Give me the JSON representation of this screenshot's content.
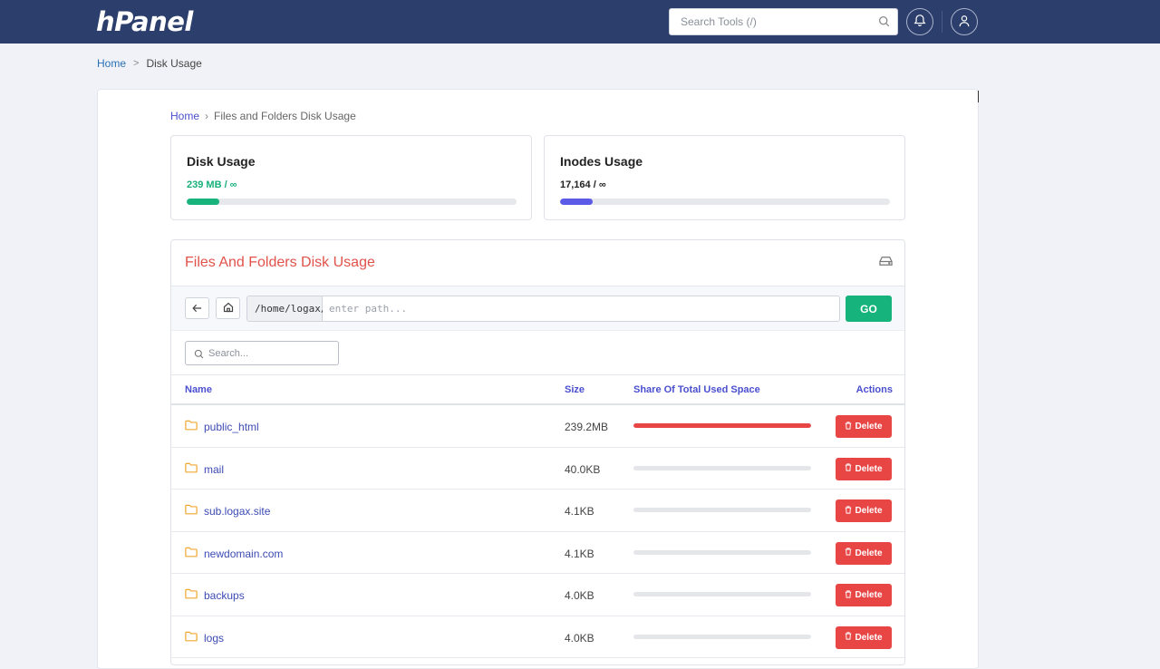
{
  "header": {
    "logo": "hPanel",
    "search_placeholder": "Search Tools (/)"
  },
  "breadcrumb_top": {
    "home": "Home",
    "separator": ">",
    "current": "Disk Usage"
  },
  "breadcrumb_inner": {
    "home": "Home",
    "separator": "›",
    "current": "Files and Folders Disk Usage"
  },
  "disk_usage": {
    "title": "Disk Usage",
    "value": "239 MB / ∞",
    "progress": 0.1,
    "color": "#16b37c"
  },
  "inodes_usage": {
    "title": "Inodes Usage",
    "value": "17,164 / ∞",
    "progress": 0.1,
    "color": "#5b5be8"
  },
  "files_panel": {
    "title": "Files And Folders Disk Usage",
    "title_color": "#e0524a",
    "path_prefix": "/home/logax/",
    "path_placeholder": "enter path...",
    "go_label": "GO",
    "search_placeholder": "Search...",
    "columns": {
      "name": "Name",
      "size": "Size",
      "share": "Share Of Total Used Space",
      "actions": "Actions"
    },
    "rows": [
      {
        "name": "public_html",
        "size": "239.2MB",
        "share": 1.0,
        "action": "Delete"
      },
      {
        "name": "mail",
        "size": "40.0KB",
        "share": 0.0,
        "action": "Delete"
      },
      {
        "name": "sub.logax.site",
        "size": "4.1KB",
        "share": 0.0,
        "action": "Delete"
      },
      {
        "name": "newdomain.com",
        "size": "4.1KB",
        "share": 0.0,
        "action": "Delete"
      },
      {
        "name": "backups",
        "size": "4.0KB",
        "share": 0.0,
        "action": "Delete"
      },
      {
        "name": "logs",
        "size": "4.0KB",
        "share": 0.0,
        "action": "Delete"
      }
    ]
  },
  "icons": {
    "search": "search-icon",
    "notifications": "bell-icon",
    "user": "user-icon",
    "drive": "hard-drive-icon",
    "back": "arrow-left-icon",
    "home": "home-icon",
    "folder": "folder-icon",
    "trash": "trash-icon"
  }
}
